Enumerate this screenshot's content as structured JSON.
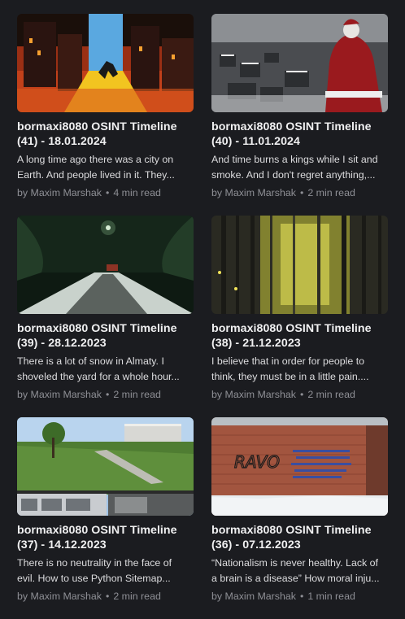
{
  "posts": [
    {
      "title_line1": "bormaxi8080 OSINT Timeline",
      "title_line2": "(41) - 18.01.2024",
      "excerpt_line1": "A long time ago there was a city on",
      "excerpt_line2": "Earth. And people lived in it. They...",
      "author": "by Maxim Marshak",
      "separator": "•",
      "read_time": "4 min read"
    },
    {
      "title_line1": "bormaxi8080 OSINT Timeline",
      "title_line2": "(40) - 11.01.2024",
      "excerpt_line1": "And time burns a kings while I sit and",
      "excerpt_line2": "smoke. And I don't regret anything,...",
      "author": "by Maxim Marshak",
      "separator": "•",
      "read_time": "2 min read"
    },
    {
      "title_line1": "bormaxi8080 OSINT Timeline",
      "title_line2": "(39) - 28.12.2023",
      "excerpt_line1": "There is a lot of snow in Almaty. I",
      "excerpt_line2": "shoveled the yard for a whole hour...",
      "author": "by Maxim Marshak",
      "separator": "•",
      "read_time": "2 min read"
    },
    {
      "title_line1": "bormaxi8080 OSINT Timeline",
      "title_line2": "(38) - 21.12.2023",
      "excerpt_line1": "I believe that in order for people to",
      "excerpt_line2": "think, they must be in a little pain....",
      "author": "by Maxim Marshak",
      "separator": "•",
      "read_time": "2 min read"
    },
    {
      "title_line1": "bormaxi8080 OSINT Timeline",
      "title_line2": "(37) - 14.12.2023",
      "excerpt_line1": "There is no neutrality in the face of",
      "excerpt_line2": "evil. How to use Python Sitemap...",
      "author": "by Maxim Marshak",
      "separator": "•",
      "read_time": "2 min read"
    },
    {
      "title_line1": "bormaxi8080 OSINT Timeline",
      "title_line2": "(36) - 07.12.2023",
      "excerpt_line1": "“Nationalism is never healthy. Lack of",
      "excerpt_line2": "a brain is a disease” How moral inju...",
      "author": "by Maxim Marshak",
      "separator": "•",
      "read_time": "1 min read"
    }
  ],
  "graffiti_text": "RAVO"
}
